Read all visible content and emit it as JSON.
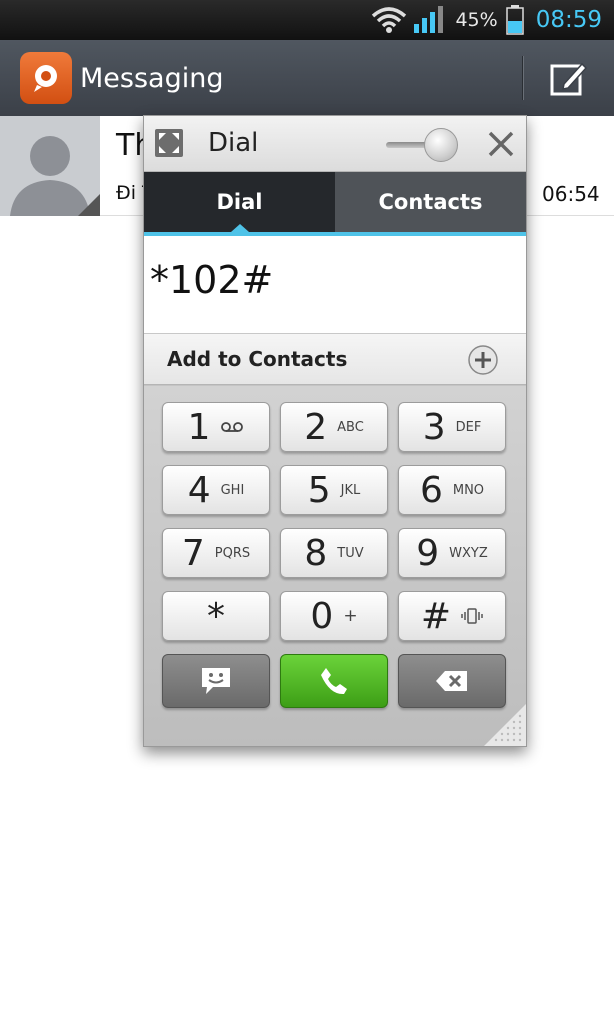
{
  "status_bar": {
    "battery_percent": "45%",
    "time": "08:59",
    "accent_color": "#47c8f5"
  },
  "app_bar": {
    "title": "Messaging"
  },
  "conversation": {
    "name": "Th",
    "preview": "Đi T",
    "time": "06:54"
  },
  "dial_popup": {
    "title": "Dial",
    "tabs": [
      {
        "label": "Dial",
        "active": true
      },
      {
        "label": "Contacts",
        "active": false
      }
    ],
    "dialed_number": "*102#",
    "add_to_contacts_label": "Add to Contacts",
    "keys": [
      {
        "digit": "1",
        "letters": ""
      },
      {
        "digit": "2",
        "letters": "ABC"
      },
      {
        "digit": "3",
        "letters": "DEF"
      },
      {
        "digit": "4",
        "letters": "GHI"
      },
      {
        "digit": "5",
        "letters": "JKL"
      },
      {
        "digit": "6",
        "letters": "MNO"
      },
      {
        "digit": "7",
        "letters": "PQRS"
      },
      {
        "digit": "8",
        "letters": "TUV"
      },
      {
        "digit": "9",
        "letters": "WXYZ"
      },
      {
        "digit": "*",
        "letters": ""
      },
      {
        "digit": "0",
        "letters": "+"
      },
      {
        "digit": "#",
        "letters": ""
      }
    ],
    "call_color": "#4caf2a"
  }
}
